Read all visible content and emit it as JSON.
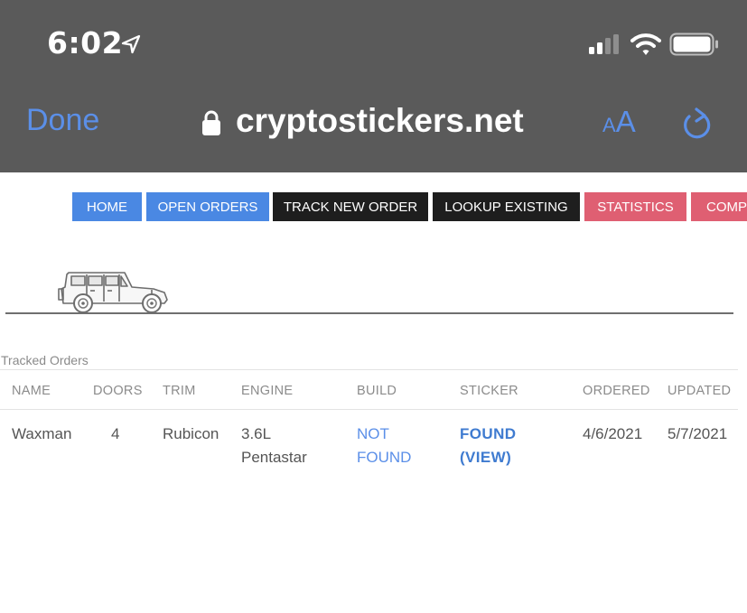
{
  "status_bar": {
    "time": "6:02",
    "icons": [
      "location-arrow-icon",
      "cellular-signal-icon",
      "wifi-icon",
      "battery-icon"
    ]
  },
  "browser_bar": {
    "done_label": "Done",
    "url": "cryptostickers.net",
    "text_size_small": "A",
    "text_size_large": "A",
    "icons": [
      "lock-icon",
      "reload-icon"
    ]
  },
  "nav": {
    "items": [
      {
        "label": "HOME",
        "color": "#4a88e3"
      },
      {
        "label": "OPEN ORDERS",
        "color": "#4a88e3"
      },
      {
        "label": "TRACK NEW ORDER",
        "color": "#1e1e1e"
      },
      {
        "label": "LOOKUP EXISTING",
        "color": "#1e1e1e"
      },
      {
        "label": "STATISTICS",
        "color": "#df5f72"
      },
      {
        "label": "COMP",
        "color": "#df5f72"
      }
    ]
  },
  "tracked_orders": {
    "caption": "Tracked Orders",
    "headers": [
      "NAME",
      "DOORS",
      "TRIM",
      "ENGINE",
      "BUILD",
      "STICKER",
      "ORDERED",
      "UPDATED"
    ],
    "row": {
      "name": "Waxman",
      "doors": "4",
      "trim": "Rubicon",
      "engine_line1": "3.6L",
      "engine_line2": "Pentastar",
      "build_line1": "NOT",
      "build_line2": "FOUND",
      "sticker_line1": "FOUND",
      "sticker_line2": "(VIEW)",
      "ordered": "4/6/2021",
      "updated": "5/7/2021"
    }
  },
  "colors": {
    "topbar": "#5a5a5a",
    "ios_blue": "#5b8fe8",
    "nav_blue": "#4a88e3",
    "nav_dark": "#1e1e1e",
    "nav_red": "#df5f72"
  }
}
